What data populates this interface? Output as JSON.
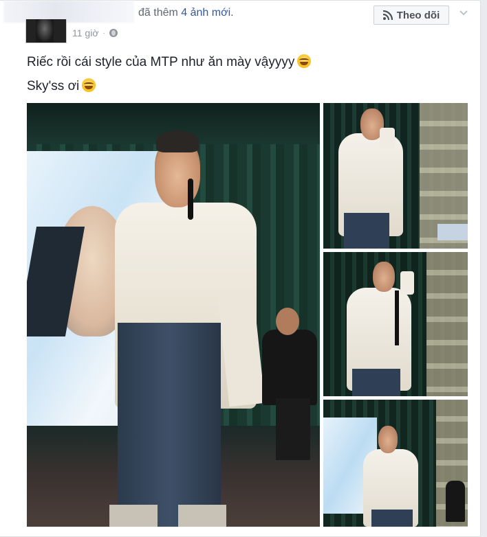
{
  "post": {
    "header_action": "đã thêm",
    "header_link": "4 ảnh mới.",
    "timestamp": "11 giờ",
    "dot": "·",
    "follow_label": "Theo dõi",
    "line1": "Riếc rồi cái style của MTP như ăn mày vậyyyy",
    "line2": "Sky'ss ơi"
  },
  "icons": {
    "privacy": "globe-icon",
    "follow": "rss-icon",
    "menu": "chevron-down-icon",
    "emoji": "laughing-tears-emoji"
  },
  "colors": {
    "link": "#365899",
    "meta": "#90949c",
    "text": "#1d2129"
  }
}
